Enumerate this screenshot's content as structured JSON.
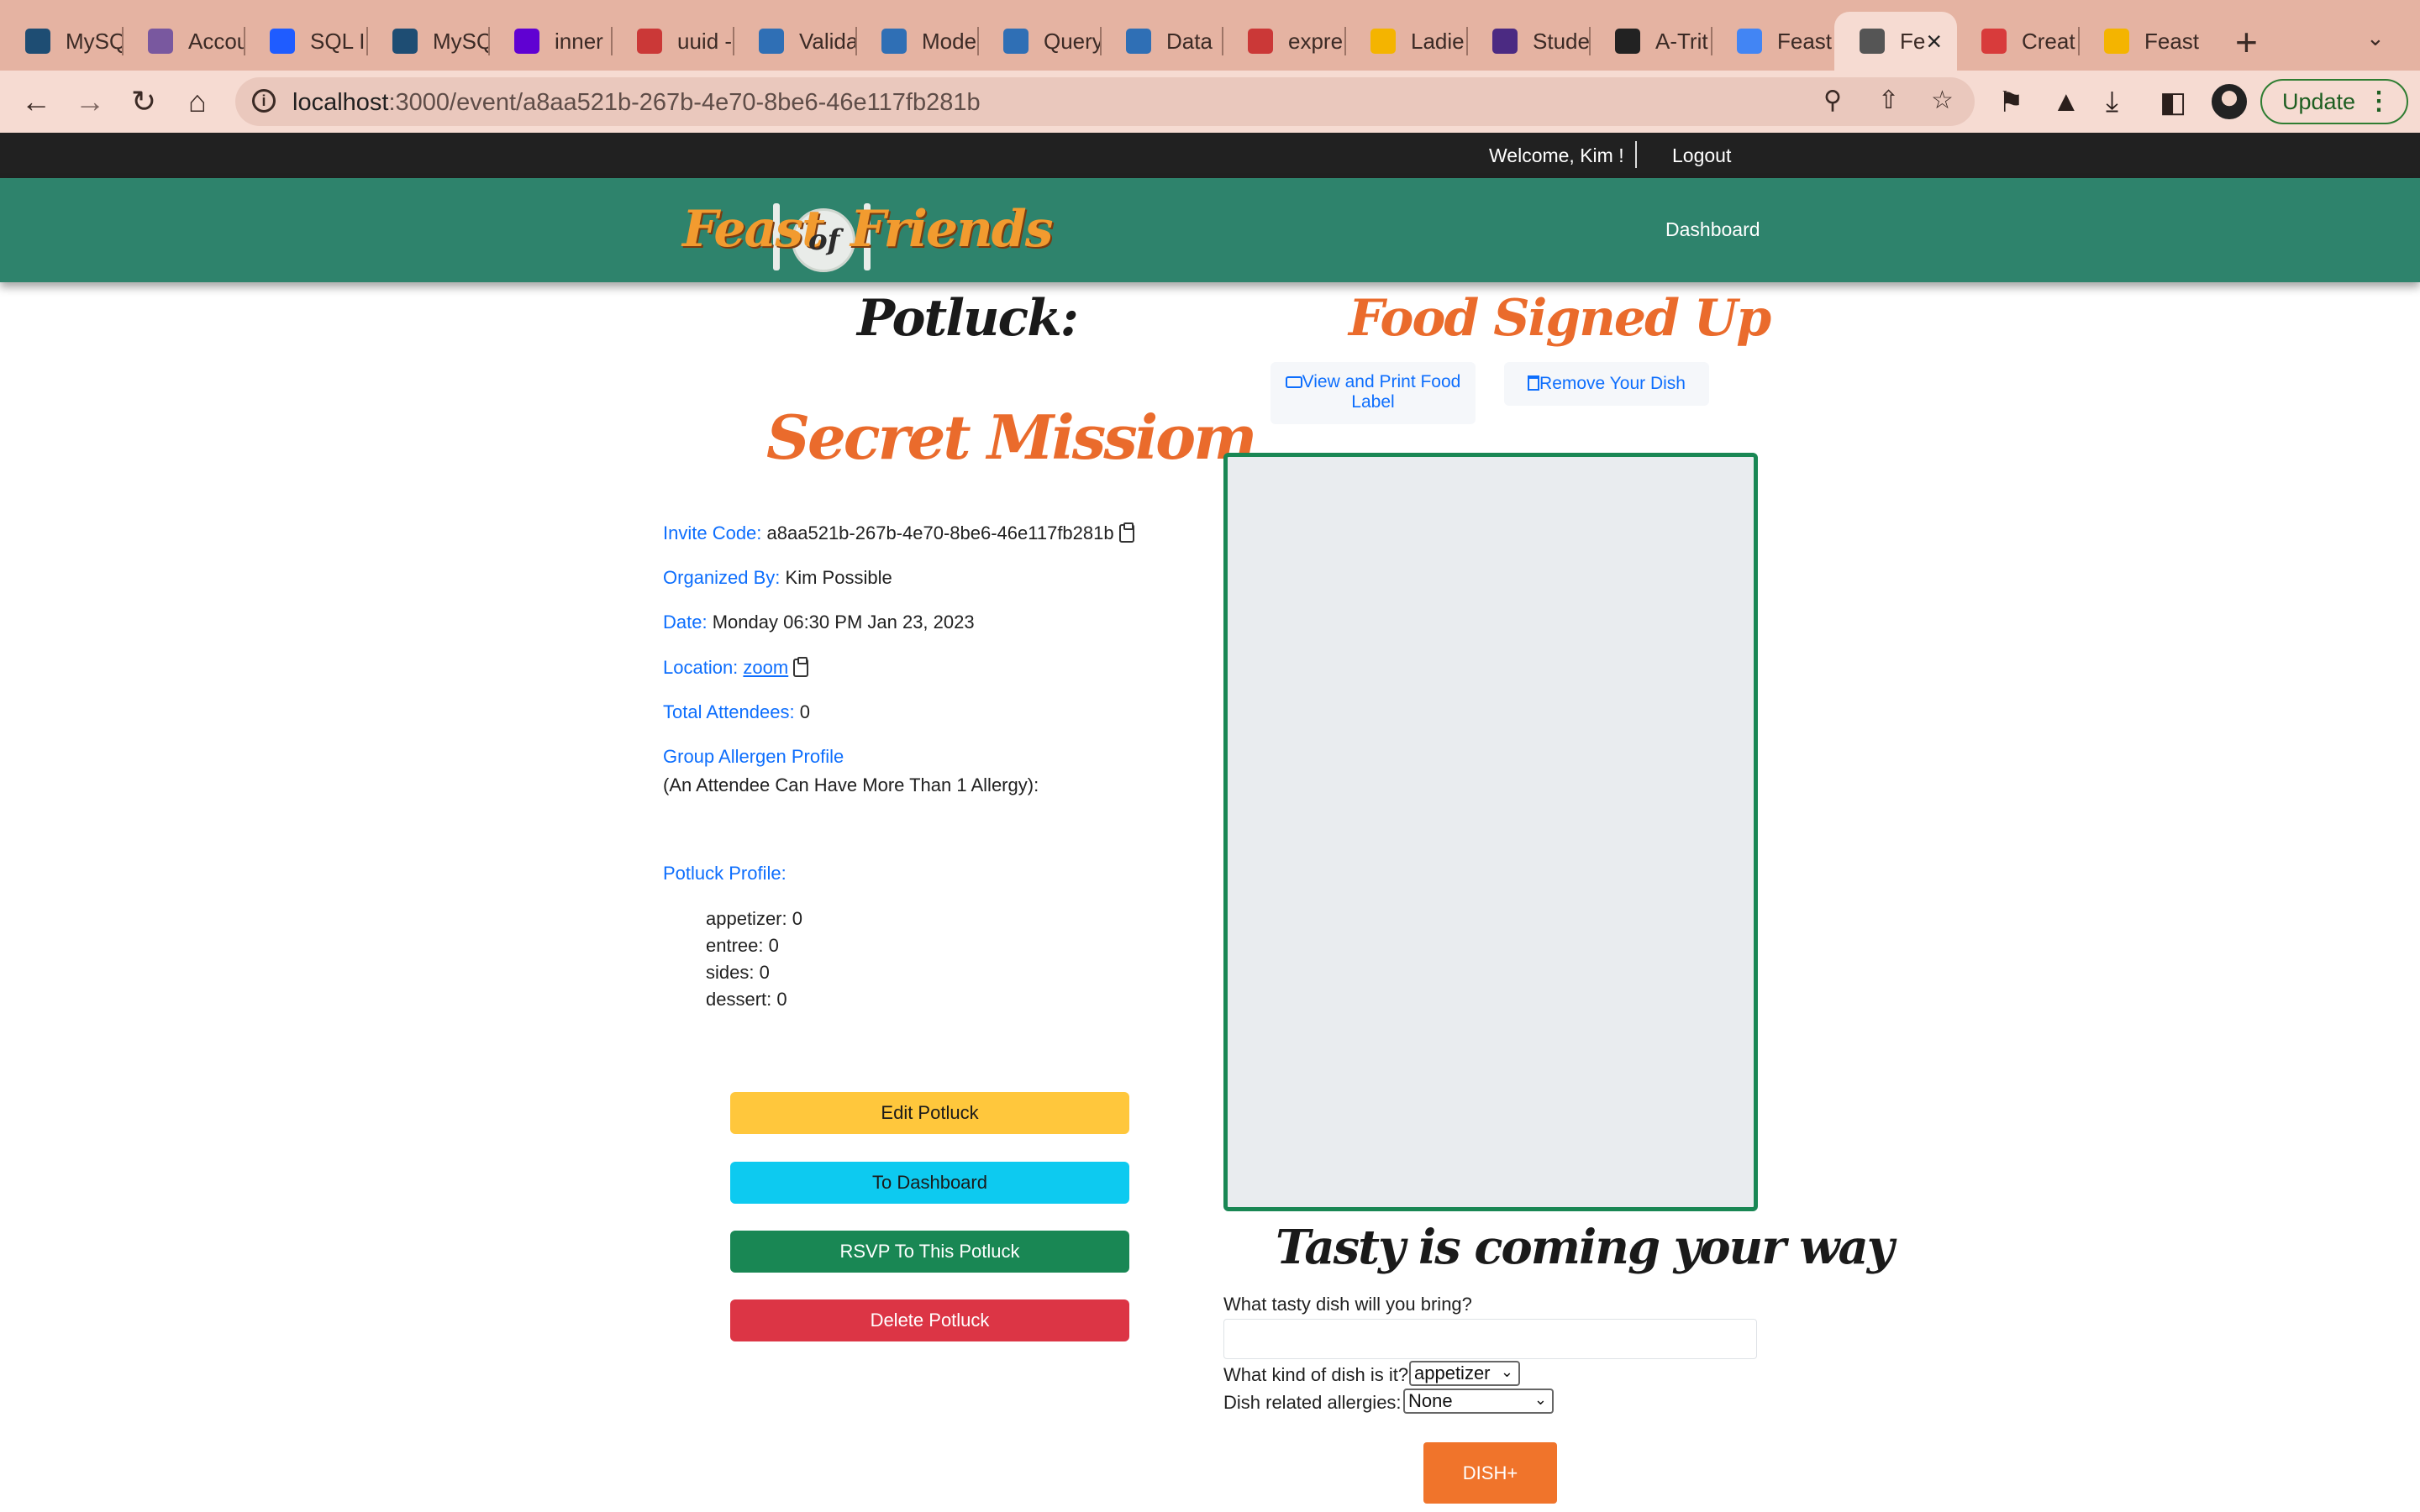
{
  "browser": {
    "tabs": [
      {
        "label": "MySQ",
        "icon": "mysql-icon",
        "color": "#1e4d73"
      },
      {
        "label": "Accou",
        "icon": "heroku-icon",
        "color": "#79589f"
      },
      {
        "label": "SQL I",
        "icon": "dot-icon",
        "color": "#1f5cff"
      },
      {
        "label": "MySQ",
        "icon": "mysql-icon",
        "color": "#1e4d73"
      },
      {
        "label": "inner",
        "icon": "yahoo-icon",
        "color": "#6001d2"
      },
      {
        "label": "uuid -",
        "icon": "npm-icon",
        "color": "#cb3837"
      },
      {
        "label": "Valida",
        "icon": "sequelize-icon",
        "color": "#2f6fb5"
      },
      {
        "label": "Mode",
        "icon": "sequelize-icon",
        "color": "#2f6fb5"
      },
      {
        "label": "Query",
        "icon": "sequelize-icon",
        "color": "#2f6fb5"
      },
      {
        "label": "Data ",
        "icon": "sequelize-icon",
        "color": "#2f6fb5"
      },
      {
        "label": "expre",
        "icon": "npm-icon",
        "color": "#cb3837"
      },
      {
        "label": "Ladie",
        "icon": "slides-icon",
        "color": "#f4b400"
      },
      {
        "label": "Stude",
        "icon": "notion-n-icon",
        "color": "#4b2a82"
      },
      {
        "label": "A-Trit",
        "icon": "github-icon",
        "color": "#222222"
      },
      {
        "label": "Feast",
        "icon": "docs-icon",
        "color": "#4285f4"
      },
      {
        "label": "Fe",
        "icon": "globe-icon",
        "color": "#555555"
      },
      {
        "label": "Creat",
        "icon": "heroku-wave-icon",
        "color": "#d83b3b"
      },
      {
        "label": "Feast",
        "icon": "slides-icon",
        "color": "#f4b400"
      }
    ],
    "url_host": "localhost",
    "url_path": ":3000/event/a8aa521b-267b-4e70-8be6-46e117fb281b",
    "update_label": "Update"
  },
  "site": {
    "welcome": "Welcome, Kim !",
    "logout": "Logout",
    "dashboard": "Dashboard",
    "logo_word1": "Feast",
    "logo_of": "of",
    "logo_word2": "Friends"
  },
  "event": {
    "heading": "Potluck:",
    "name": "Secret Missiom",
    "invite_label": "Invite Code:",
    "invite_code": "a8aa521b-267b-4e70-8be6-46e117fb281b",
    "organizer_label": "Organized By:",
    "organizer": "Kim Possible",
    "date_label": "Date:",
    "date": "Monday 06:30 PM Jan 23, 2023",
    "location_label": "Location:",
    "location": "zoom",
    "attendees_label": "Total Attendees:",
    "attendees": "0",
    "allergen_label": "Group Allergen Profile",
    "allergen_note": "(An Attendee Can Have More Than 1 Allergy):",
    "profile_label": "Potluck Profile:",
    "profile": [
      "appetizer: 0",
      "entree: 0",
      "sides: 0",
      "dessert: 0"
    ],
    "buttons": {
      "edit": "Edit Potluck",
      "dashboard": "To Dashboard",
      "rsvp": "RSVP To This Potluck",
      "delete": "Delete Potluck"
    }
  },
  "food": {
    "heading": "Food Signed Up",
    "print_label": "View and Print Food Label",
    "remove_label": "Remove Your Dish",
    "tasty_heading": "Tasty is coming your way",
    "dish_question": "What tasty dish will you bring?",
    "dish_value": "",
    "kind_question": "What kind of dish is it?",
    "kind_value": "appetizer",
    "allergy_question": "Dish related allergies:",
    "allergy_value": "None",
    "submit": "DISH+"
  }
}
